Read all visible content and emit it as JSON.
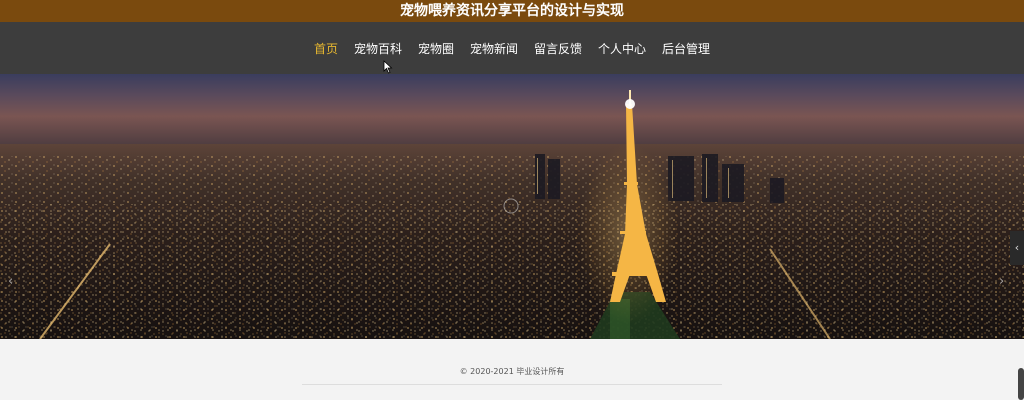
{
  "header": {
    "title": "宠物喂养资讯分享平台的设计与实现"
  },
  "nav": {
    "items": [
      {
        "label": "首页",
        "active": true
      },
      {
        "label": "宠物百科",
        "active": false
      },
      {
        "label": "宠物圈",
        "active": false
      },
      {
        "label": "宠物新闻",
        "active": false
      },
      {
        "label": "留言反馈",
        "active": false
      },
      {
        "label": "个人中心",
        "active": false
      },
      {
        "label": "后台管理",
        "active": false
      }
    ]
  },
  "banner": {
    "prev_icon": "‹",
    "next_icon": "›",
    "side_icon": "‹",
    "slide_count": 3,
    "active_slide": 1
  },
  "footer": {
    "copyright": "© 2020-2021 毕业设计所有"
  },
  "colors": {
    "title_bar": "#7a4a0e",
    "nav_bar": "#3d3d3d",
    "nav_active": "#e8b830",
    "footer_bg": "#f3f3f3"
  }
}
